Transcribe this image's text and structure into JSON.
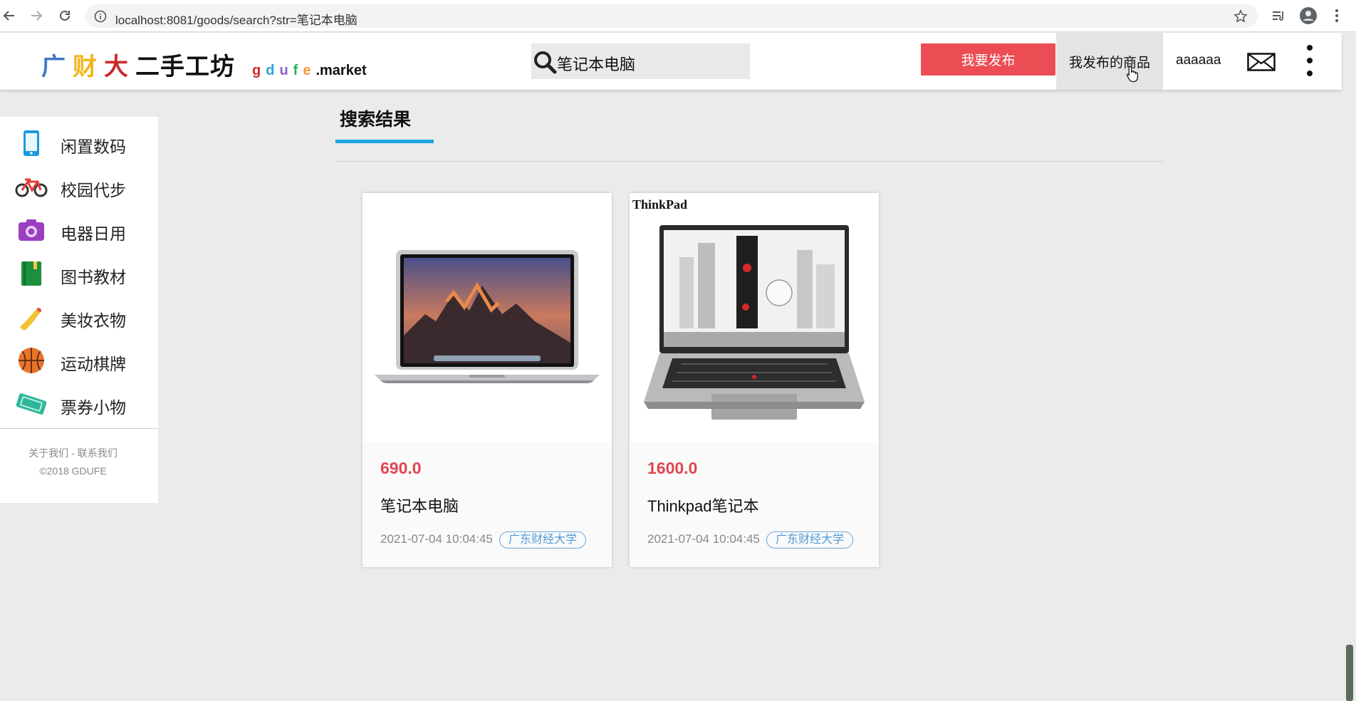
{
  "browser": {
    "url": "localhost:8081/goods/search?str=笔记本电脑"
  },
  "header": {
    "logo_cn": [
      "广",
      "财",
      "大"
    ],
    "logo_cn_colors": [
      "#3f79c8",
      "#f2b51b",
      "#c92a2a"
    ],
    "logo_cn_rest": "二手工坊",
    "logo_letters": [
      "g",
      "d",
      "u",
      "f",
      "e"
    ],
    "logo_letter_colors": [
      "#c92a2a",
      "#2aa5d8",
      "#8b63c9",
      "#2fae5a",
      "#f29c38"
    ],
    "logo_market": ".market",
    "search_value": "笔记本电脑",
    "publish_label": "我要发布",
    "my_goods_label": "我发布的商品",
    "username": "aaaaaa"
  },
  "sidebar": {
    "categories": [
      {
        "label": "闲置数码",
        "icon": "phone-icon"
      },
      {
        "label": "校园代步",
        "icon": "bicycle-icon"
      },
      {
        "label": "电器日用",
        "icon": "camera-icon"
      },
      {
        "label": "图书教材",
        "icon": "book-icon"
      },
      {
        "label": "美妆衣物",
        "icon": "lipstick-icon"
      },
      {
        "label": "运动棋牌",
        "icon": "basketball-icon"
      },
      {
        "label": "票券小物",
        "icon": "ticket-icon"
      }
    ],
    "footer_links": "关于我们 - 联系我们",
    "copyright": "©2018 GDUFE"
  },
  "main": {
    "section_title": "搜索结果",
    "products": [
      {
        "price": "690.0",
        "title": "笔记本电脑",
        "date": "2021-07-04 10:04:45",
        "school": "广东财经大学",
        "image": "macbook-image"
      },
      {
        "price": "1600.0",
        "title": "Thinkpad笔记本",
        "date": "2021-07-04 10:04:45",
        "school": "广东财经大学",
        "image": "thinkpad-image",
        "image_brand": "ThinkPad"
      }
    ]
  },
  "colors": {
    "accent_blue": "#1aa6e0",
    "publish_red": "#ec4c53",
    "price_red": "#e0474f"
  }
}
